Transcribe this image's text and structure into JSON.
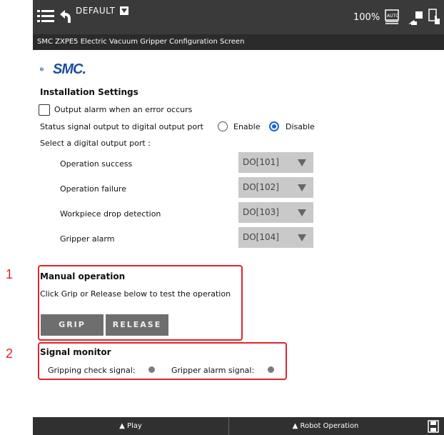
{
  "header": {
    "program_name": "DEFAULT",
    "speed": "100%",
    "screen_title": "SMC ZXPE5 Electric Vacuum Gripper Configuration Screen"
  },
  "logo": {
    "text": "SMC."
  },
  "installation": {
    "title": "Installation Settings",
    "output_alarm_label": "Output alarm when an error occurs",
    "output_alarm_checked": false,
    "status_signal_label": "Status signal output to digital output port",
    "enable_label": "Enable",
    "disable_label": "Disable",
    "selected": "Disable",
    "select_port_label": "Select a digital output port :",
    "ports": [
      {
        "label": "Operation success",
        "value": "DO[101]"
      },
      {
        "label": "Operation failure",
        "value": "DO[102]"
      },
      {
        "label": "Workpiece drop detection",
        "value": "DO[103]"
      },
      {
        "label": "Gripper alarm",
        "value": "DO[104]"
      }
    ]
  },
  "manual": {
    "marker": "1",
    "title": "Manual operation",
    "description": "Click Grip or Release below to test the operation",
    "grip_label": "GRIP",
    "release_label": "RELEASE"
  },
  "monitor": {
    "marker": "2",
    "title": "Signal monitor",
    "gripping_label": "Gripping check signal:",
    "alarm_label": "Gripper alarm signal:"
  },
  "footer": {
    "play_label": "▲ Play",
    "robot_label": "▲ Robot Operation"
  },
  "colors": {
    "accent": "#1565d8",
    "annotation": "#e0242a",
    "logo": "#1d4f9c"
  }
}
